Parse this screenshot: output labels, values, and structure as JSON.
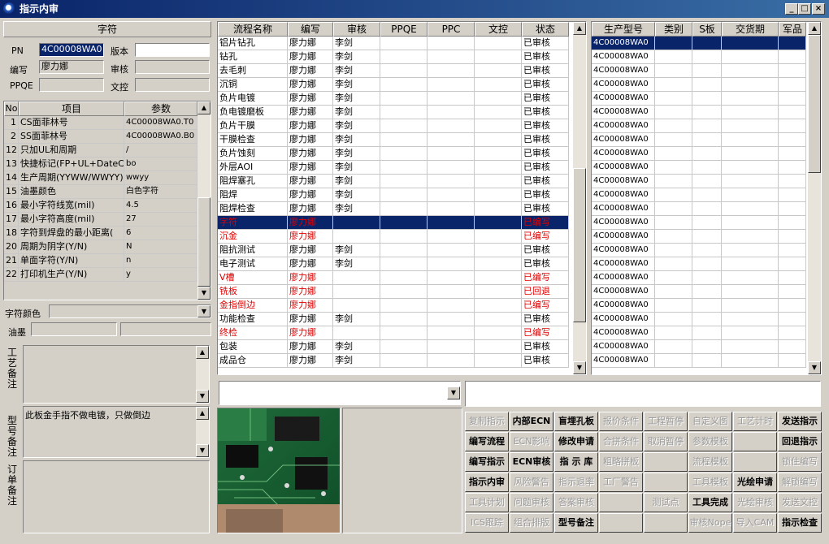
{
  "window": {
    "title": "指示内审",
    "min": "_",
    "max": "□",
    "close": "×"
  },
  "left": {
    "section_title": "字符",
    "pn_label": "PN",
    "pn_value": "4C00008WA0",
    "version_label": "版本",
    "version_value": "",
    "author_label": "编写",
    "author_value": "廖力娜",
    "review_label": "审核",
    "review_value": "",
    "ppqe_label": "PPQE",
    "ppqe_value": "",
    "doc_label": "文控",
    "doc_value": "",
    "params_headers": [
      "No",
      "项目",
      "参数"
    ],
    "params": [
      {
        "no": "1",
        "item": "CS面菲林号",
        "value": "4C00008WA0.T0"
      },
      {
        "no": "2",
        "item": "SS面菲林号",
        "value": "4C00008WA0.B0"
      },
      {
        "no": "12",
        "item": "只加UL和周期",
        "value": "/"
      },
      {
        "no": "13",
        "item": "快捷标记(FP+UL+DateCo",
        "value": "bo"
      },
      {
        "no": "14",
        "item": "生产周期(YYWW/WWYY)",
        "value": "wwyy"
      },
      {
        "no": "15",
        "item": "油墨颜色",
        "value": "白色字符"
      },
      {
        "no": "16",
        "item": "最小字符线宽(mil)",
        "value": "4.5"
      },
      {
        "no": "17",
        "item": "最小字符高度(mil)",
        "value": "27"
      },
      {
        "no": "18",
        "item": "字符到焊盘的最小距离(",
        "value": "6"
      },
      {
        "no": "20",
        "item": "周期为阴字(Y/N)",
        "value": "N"
      },
      {
        "no": "21",
        "item": "单面字符(Y/N)",
        "value": "n"
      },
      {
        "no": "22",
        "item": "打印机生产(Y/N)",
        "value": "y"
      }
    ],
    "color_label": "字符颜色",
    "ink_label": "油墨",
    "process_note_label": "工艺备注",
    "model_note_label": "型号备注",
    "model_note_text": "此板金手指不做电镀，只做倒边",
    "order_note_label": "订单备注"
  },
  "process": {
    "headers": [
      "流程名称",
      "编写",
      "审核",
      "PPQE",
      "PPC",
      "文控",
      "状态"
    ],
    "rows": [
      {
        "name": "铝片钻孔",
        "author": "廖力娜",
        "reviewer": "李剑",
        "status": "已审核",
        "red": false
      },
      {
        "name": "钻孔",
        "author": "廖力娜",
        "reviewer": "李剑",
        "status": "已审核",
        "red": false
      },
      {
        "name": "去毛刺",
        "author": "廖力娜",
        "reviewer": "李剑",
        "status": "已审核",
        "red": false
      },
      {
        "name": "沉铜",
        "author": "廖力娜",
        "reviewer": "李剑",
        "status": "已审核",
        "red": false
      },
      {
        "name": "负片电镀",
        "author": "廖力娜",
        "reviewer": "李剑",
        "status": "已审核",
        "red": false
      },
      {
        "name": "负电镀磨板",
        "author": "廖力娜",
        "reviewer": "李剑",
        "status": "已审核",
        "red": false
      },
      {
        "name": "负片干膜",
        "author": "廖力娜",
        "reviewer": "李剑",
        "status": "已审核",
        "red": false
      },
      {
        "name": "干膜检查",
        "author": "廖力娜",
        "reviewer": "李剑",
        "status": "已审核",
        "red": false
      },
      {
        "name": "负片蚀刻",
        "author": "廖力娜",
        "reviewer": "李剑",
        "status": "已审核",
        "red": false
      },
      {
        "name": "外层AOI",
        "author": "廖力娜",
        "reviewer": "李剑",
        "status": "已审核",
        "red": false
      },
      {
        "name": "阻焊塞孔",
        "author": "廖力娜",
        "reviewer": "李剑",
        "status": "已审核",
        "red": false
      },
      {
        "name": "阻焊",
        "author": "廖力娜",
        "reviewer": "李剑",
        "status": "已审核",
        "red": false
      },
      {
        "name": "阻焊检查",
        "author": "廖力娜",
        "reviewer": "李剑",
        "status": "已审核",
        "red": false
      },
      {
        "name": "字符",
        "author": "廖力娜",
        "reviewer": "",
        "status": "已编写",
        "red": true
      },
      {
        "name": "沉金",
        "author": "廖力娜",
        "reviewer": "",
        "status": "已编写",
        "red": true
      },
      {
        "name": "阻抗测试",
        "author": "廖力娜",
        "reviewer": "李剑",
        "status": "已审核",
        "red": false
      },
      {
        "name": "电子测试",
        "author": "廖力娜",
        "reviewer": "李剑",
        "status": "已审核",
        "red": false
      },
      {
        "name": "V槽",
        "author": "廖力娜",
        "reviewer": "",
        "status": "已编写",
        "red": true
      },
      {
        "name": "铣板",
        "author": "廖力娜",
        "reviewer": "",
        "status": "已回退",
        "red": true
      },
      {
        "name": "金指倒边",
        "author": "廖力娜",
        "reviewer": "",
        "status": "已编写",
        "red": true
      },
      {
        "name": "功能检查",
        "author": "廖力娜",
        "reviewer": "李剑",
        "status": "已审核",
        "red": false
      },
      {
        "name": "终检",
        "author": "廖力娜",
        "reviewer": "",
        "status": "已编写",
        "red": true
      },
      {
        "name": "包装",
        "author": "廖力娜",
        "reviewer": "李剑",
        "status": "已审核",
        "red": false
      },
      {
        "name": "成品仓",
        "author": "廖力娜",
        "reviewer": "李剑",
        "status": "已审核",
        "red": false
      }
    ]
  },
  "models": {
    "headers": [
      "生产型号",
      "类别",
      "S板",
      "交货期",
      "军品"
    ],
    "rows": [
      "4C00008WA0",
      "4C00008WA0",
      "4C00008WA0",
      "4C00008WA0",
      "4C00008WA0",
      "4C00008WA0",
      "4C00008WA0",
      "4C00008WA0",
      "4C00008WA0",
      "4C00008WA0",
      "4C00008WA0",
      "4C00008WA0",
      "4C00008WA0",
      "4C00008WA0",
      "4C00008WA0",
      "4C00008WA0",
      "4C00008WA0",
      "4C00008WA0",
      "4C00008WA0",
      "4C00008WA0",
      "4C00008WA0",
      "4C00008WA0",
      "4C00008WA0",
      "4C00008WA0"
    ]
  },
  "buttons": [
    [
      "复制指示",
      "内部ECN",
      "盲埋孔板",
      "报价条件",
      "工程暂停",
      "自定义图",
      "工艺计时",
      "发送指示"
    ],
    [
      "编写流程",
      "ECN影响",
      "修改申请",
      "合拼条件",
      "取消暂停",
      "参数模板",
      "",
      "回退指示"
    ],
    [
      "编写指示",
      "ECN审核",
      "指 示 库",
      "粗略拼板",
      "",
      "流程模板",
      "",
      "锁住编写"
    ],
    [
      "指示内审",
      "风险警告",
      "指示退率",
      "工厂警告",
      "",
      "工具模板",
      "光绘申请",
      "解锁编写"
    ],
    [
      "工具计划",
      "问题审核",
      "答案审核",
      "",
      "测试点",
      "工具完成",
      "光绘审核",
      "发送文控"
    ],
    [
      "ICS跟踪",
      "组合排版",
      "型号备注",
      "",
      "",
      "审核Nope",
      "导入CAM",
      "指示检查"
    ]
  ],
  "button_enabled": [
    [
      false,
      true,
      true,
      false,
      false,
      false,
      false,
      true
    ],
    [
      true,
      false,
      true,
      false,
      false,
      false,
      false,
      true
    ],
    [
      true,
      true,
      true,
      false,
      false,
      false,
      false,
      false
    ],
    [
      true,
      false,
      false,
      false,
      false,
      false,
      true,
      false
    ],
    [
      false,
      false,
      false,
      false,
      false,
      true,
      false,
      false
    ],
    [
      false,
      false,
      true,
      false,
      false,
      false,
      false,
      true
    ]
  ]
}
